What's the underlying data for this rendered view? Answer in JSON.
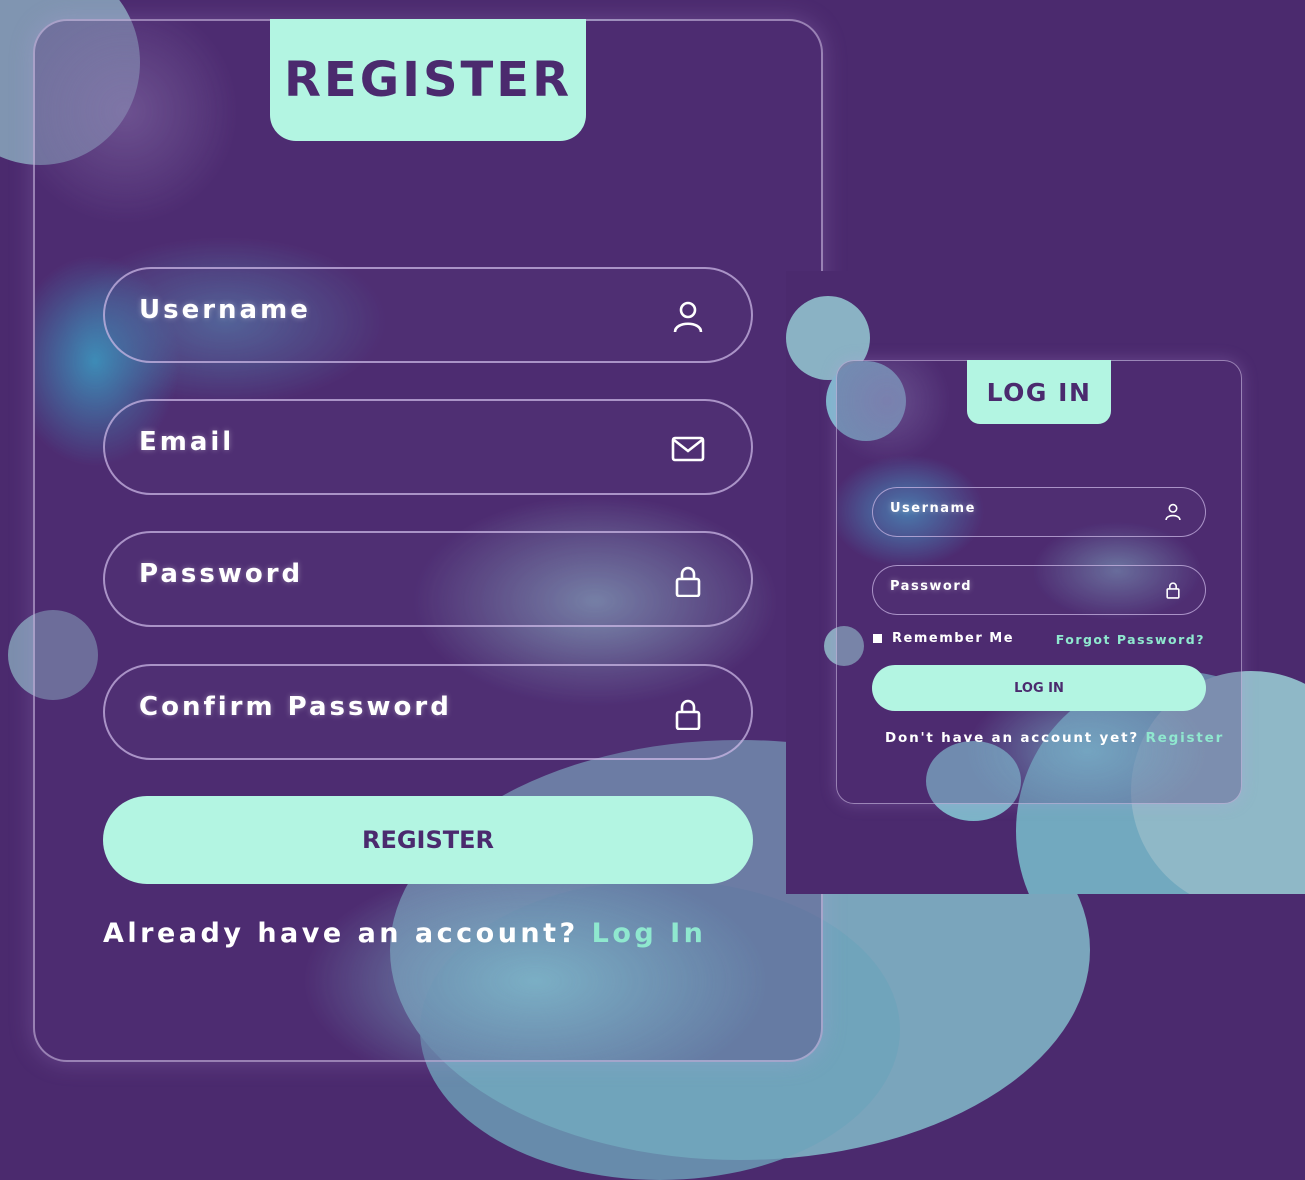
{
  "register": {
    "title": "REGISTER",
    "fields": [
      {
        "label": "Username",
        "icon": "user-icon"
      },
      {
        "label": "Email",
        "icon": "mail-icon"
      },
      {
        "label": "Password",
        "icon": "lock-icon"
      },
      {
        "label": "Confirm Password",
        "icon": "lock-icon"
      }
    ],
    "button": "REGISTER",
    "footer_text": "Already have an account?",
    "footer_link": "Log In"
  },
  "login": {
    "title": "LOG IN",
    "fields": [
      {
        "label": "Username",
        "icon": "user-icon"
      },
      {
        "label": "Password",
        "icon": "lock-icon"
      }
    ],
    "remember": "Remember Me",
    "forgot": "Forgot Password?",
    "button": "LOG IN",
    "footer_text": "Don't have an account yet?",
    "footer_link": "Register"
  },
  "colors": {
    "background": "#4b2a6e",
    "accent": "#b3f5e2",
    "link": "#8fe8cf",
    "text": "#ffffff"
  }
}
